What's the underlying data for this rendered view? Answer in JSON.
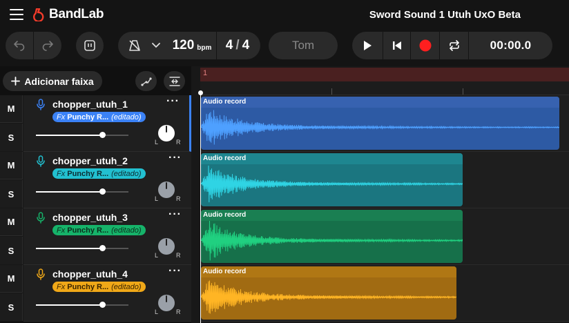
{
  "app": {
    "logo_text": "BandLab",
    "project_title": "Sword Sound 1 Utuh UxO Beta"
  },
  "toolbar": {
    "bpm": "120",
    "bpm_unit": "bpm",
    "time_sig_top": "4",
    "time_sig_sep": "/",
    "time_sig_bottom": "4",
    "key_label": "Tom",
    "time": "00:00.0"
  },
  "left_panel": {
    "add_track_label": "Adicionar faixa"
  },
  "timeline": {
    "region_label": "1"
  },
  "tracks": [
    {
      "name": "chopper_utuh_1",
      "fx_prefix": "Fx",
      "fx_name": "Punchy R...",
      "fx_state": "(editado)",
      "mute": "M",
      "solo": "S",
      "volume": 0.72,
      "pan_left": "L",
      "pan_right": "R",
      "clip_label": "Audio record",
      "color": "#3b82f6",
      "clip_color": "#2d5aa4",
      "clip_head": "#3762b0",
      "wave_color": "#4ea0ff",
      "badge_bg": "#3b82f6",
      "badge_fg": "#ffffff"
    },
    {
      "name": "chopper_utuh_2",
      "fx_prefix": "Fx",
      "fx_name": "Punchy R...",
      "fx_state": "(editado)",
      "mute": "M",
      "solo": "S",
      "volume": 0.72,
      "pan_left": "L",
      "pan_right": "R",
      "clip_label": "Audio record",
      "color": "#22c0d0",
      "clip_color": "#1b7680",
      "clip_head": "#1e8690",
      "wave_color": "#2fd4e4",
      "badge_bg": "#22c0d0",
      "badge_fg": "#0b2d33"
    },
    {
      "name": "chopper_utuh_3",
      "fx_prefix": "Fx",
      "fx_name": "Punchy R...",
      "fx_state": "(editado)",
      "mute": "M",
      "solo": "S",
      "volume": 0.72,
      "pan_left": "L",
      "pan_right": "R",
      "clip_label": "Audio record",
      "color": "#16b36a",
      "clip_color": "#16704a",
      "clip_head": "#1a7f52",
      "wave_color": "#20d080",
      "badge_bg": "#16b36a",
      "badge_fg": "#0b2d1c"
    },
    {
      "name": "chopper_utuh_4",
      "fx_prefix": "Fx",
      "fx_name": "Punchy R...",
      "fx_state": "(editado)",
      "mute": "M",
      "solo": "S",
      "volume": 0.72,
      "pan_left": "L",
      "pan_right": "R",
      "clip_label": "Audio record",
      "color": "#f0a818",
      "clip_color": "#a16b12",
      "clip_head": "#b07714",
      "wave_color": "#ffb524",
      "badge_bg": "#f0a818",
      "badge_fg": "#3a2400"
    }
  ]
}
